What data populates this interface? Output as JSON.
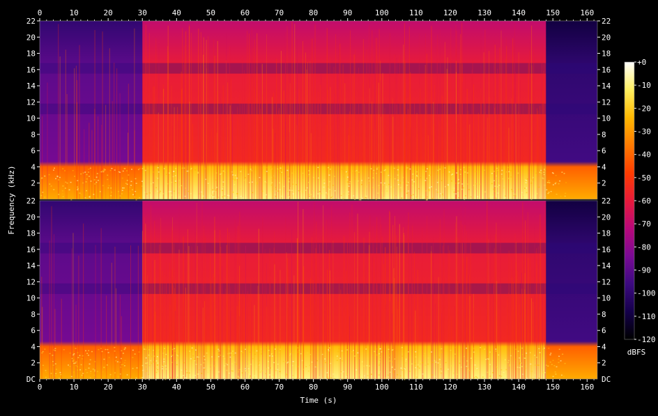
{
  "chart_data": {
    "type": "heatmap",
    "title": "",
    "xlabel": "Time (s)",
    "ylabel": "Frequency (kHz)",
    "xlim": [
      0,
      163
    ],
    "ylim": [
      0,
      22
    ],
    "x_ticks": [
      0,
      10,
      20,
      30,
      40,
      50,
      60,
      70,
      80,
      90,
      100,
      110,
      120,
      130,
      140,
      150,
      160
    ],
    "y_ticks": [
      2,
      4,
      6,
      8,
      10,
      12,
      14,
      16,
      18,
      20,
      22
    ],
    "y_bottom_label": "DC",
    "grid": false,
    "colorbar": {
      "label": "dBFS",
      "min": -120,
      "max": 0,
      "ticks": [
        "+0",
        "-10",
        "-20",
        "-30",
        "-40",
        "-50",
        "-60",
        "-70",
        "-80",
        "-90",
        "-100",
        "-110",
        "-120"
      ],
      "colors": [
        "#000000",
        "#14004a",
        "#3c0a80",
        "#7a0a94",
        "#b8087a",
        "#e81a3a",
        "#ff3c00",
        "#ff7a00",
        "#ffb800",
        "#fff060",
        "#ffffff"
      ]
    },
    "channels": [
      {
        "panel": "upper",
        "segments": [
          {
            "start": 0,
            "end": 30,
            "level_db": -85,
            "note": "sparse transients"
          },
          {
            "start": 30,
            "end": 148,
            "level_db": -55
          },
          {
            "start": 148,
            "end": 163,
            "level_db": -95
          }
        ],
        "low_band_khz": [
          0,
          4
        ],
        "low_band_level_db": -35
      },
      {
        "panel": "lower",
        "segments": [
          {
            "start": 0,
            "end": 30,
            "level_db": -85,
            "note": "sparse transients"
          },
          {
            "start": 30,
            "end": 148,
            "level_db": -55
          },
          {
            "start": 148,
            "end": 163,
            "level_db": -95
          }
        ],
        "low_band_khz": [
          0,
          4
        ],
        "low_band_level_db": -35
      }
    ]
  }
}
